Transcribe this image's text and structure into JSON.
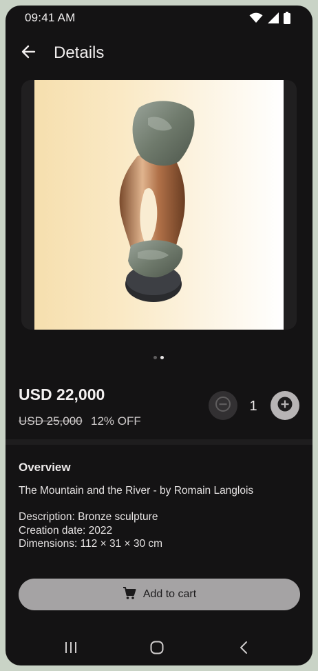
{
  "status_bar": {
    "time": "09:41 AM"
  },
  "app_bar": {
    "title": "Details"
  },
  "gallery": {
    "page_count": 2,
    "active_page": 2
  },
  "pricing": {
    "price": "USD 22,000",
    "old_price": "USD 25,000",
    "discount": "12% OFF"
  },
  "quantity": {
    "value": "1"
  },
  "overview": {
    "heading": "Overview",
    "title": "The Mountain and the River - by Romain Langlois",
    "description": "Description: Bronze sculpture",
    "creation_date": "Creation date: 2022",
    "dimensions": "Dimensions: 112 × 31 × 30 cm"
  },
  "cart": {
    "label": "Add to cart"
  },
  "colors": {
    "background": "#141314",
    "primary_button": "#a5a3a4",
    "accent_plus": "#b7b4b5",
    "frame": "#c9d3c6"
  },
  "icons": {
    "back": "arrow-left-icon",
    "wifi": "wifi-icon",
    "signal": "signal-icon",
    "battery": "battery-icon",
    "minus": "minus-circle-icon",
    "plus": "plus-circle-icon",
    "cart": "cart-icon",
    "recents": "recents-icon",
    "home": "home-icon",
    "nav_back": "nav-back-icon"
  }
}
